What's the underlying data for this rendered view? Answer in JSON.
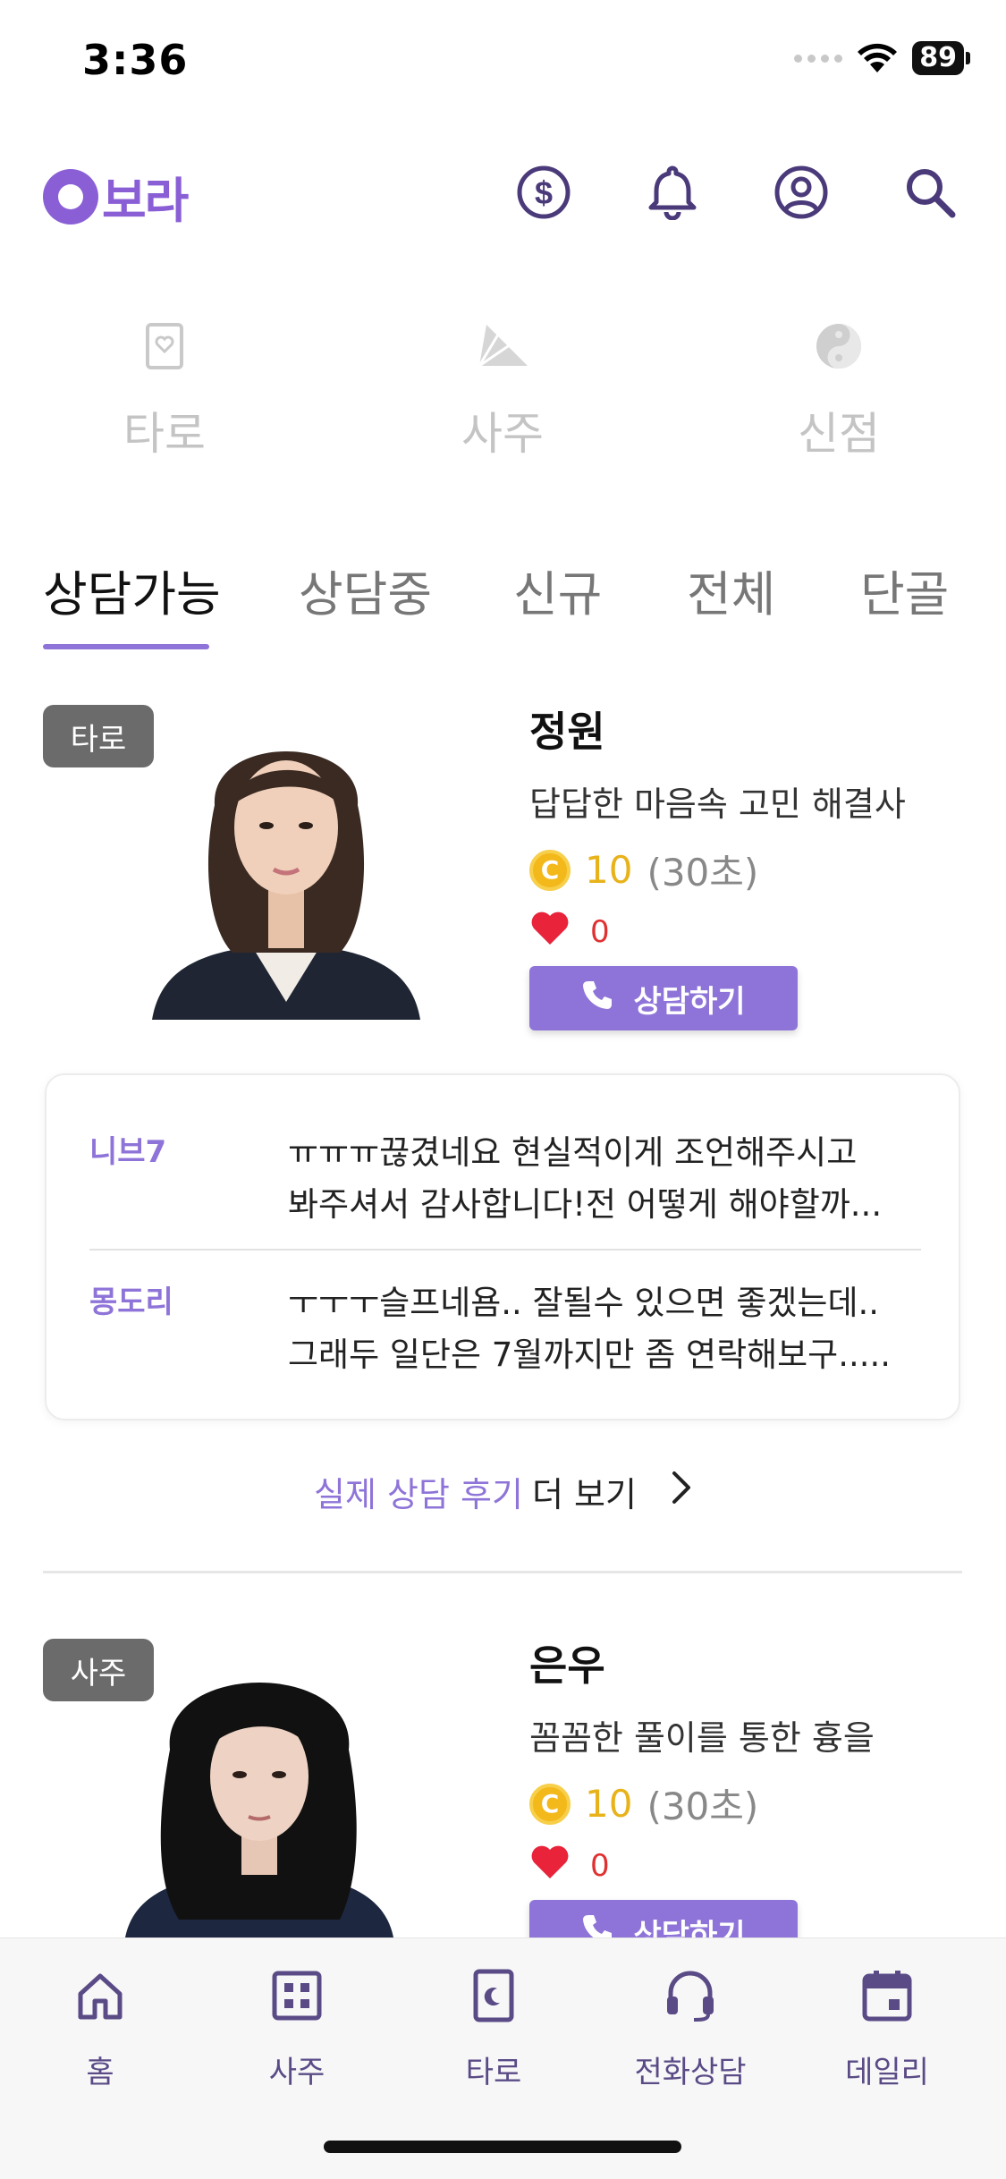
{
  "status": {
    "time": "3:36",
    "battery": "89"
  },
  "header": {
    "logo_text": "보라",
    "icons": [
      "coin-dollar-icon",
      "bell-icon",
      "user-circle-icon",
      "search-icon"
    ]
  },
  "categories": [
    {
      "label": "타로",
      "icon": "tarot-card-icon"
    },
    {
      "label": "사주",
      "icon": "fan-icon"
    },
    {
      "label": "신점",
      "icon": "yin-yang-icon"
    }
  ],
  "tabs": [
    {
      "label": "상담가능",
      "active": true
    },
    {
      "label": "상담중",
      "active": false
    },
    {
      "label": "신규",
      "active": false
    },
    {
      "label": "전체",
      "active": false
    },
    {
      "label": "단골",
      "active": false
    }
  ],
  "counselors": [
    {
      "badge": "타로",
      "name": "정원",
      "description": "답답한 마음속 고민 해결사",
      "coin_symbol": "C",
      "price": "10",
      "unit": "(30초)",
      "likes": "0",
      "button": "상담하기"
    },
    {
      "badge": "사주",
      "name": "은우",
      "description": "꼼꼼한 풀이를 통한 흉을",
      "coin_symbol": "C",
      "price": "10",
      "unit": "(30초)",
      "likes": "0",
      "button": "상담하기"
    }
  ],
  "reviews": [
    {
      "author": "니브7",
      "text": "ㅠㅠㅠ끊겼네요 현실적이게 조언해주시고\n봐주셔서 감사합니다!전 어떻게 해야할까..."
    },
    {
      "author": "몽도리",
      "text": "ㅜㅜㅜ슬프네욤.. 잘될수 있으면 좋겠는데..\n그래두 일단은 7월까지만 좀 연락해보구....."
    }
  ],
  "more_reviews": {
    "accent": "실제 상담 후기",
    "plain": "더 보기"
  },
  "bottom_nav": [
    {
      "label": "홈",
      "icon": "home-icon"
    },
    {
      "label": "사주",
      "icon": "grid-icon"
    },
    {
      "label": "타로",
      "icon": "tarot-moon-icon"
    },
    {
      "label": "전화상담",
      "icon": "headset-icon"
    },
    {
      "label": "데일리",
      "icon": "calendar-icon"
    }
  ],
  "colors": {
    "accent": "#8e74d8",
    "logo": "#8a5fd6",
    "coin": "#f3b81a",
    "heart": "#e03030",
    "nav": "#5a4b86"
  }
}
